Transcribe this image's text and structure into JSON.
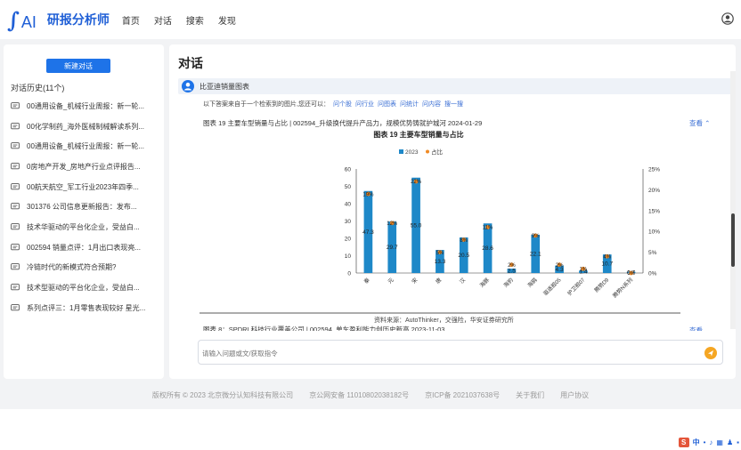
{
  "brand": {
    "logo_mark": "∫",
    "logo_text": "AI",
    "name": "研报分析师"
  },
  "nav": [
    "首页",
    "对话",
    "搜索",
    "发现"
  ],
  "sidebar": {
    "new_chat_label": "新建对话",
    "history_title": "对话历史(11个)",
    "history": [
      "00通用设备_机械行业周报：新一轮...",
      "00化学制药_海外医械制械解读系列...",
      "00通用设备_机械行业周报：新一轮...",
      "0房地产开发_房地产行业点评报告...",
      "00航天航空_军工行业2023年四季...",
      "301376 公司信息更新报告：发布...",
      "技术华驱动的平台化企业，受益白...",
      "002594 销量点评：1月出口表现亮...",
      "冷链时代的新模式符合预期?",
      "技术型驱动的平台化企业，受益白...",
      "系列点评三：1月零售表现较好 星光..."
    ]
  },
  "main": {
    "title": "对话",
    "question": "比亚迪销量图表",
    "answer_intro": "以下答案来自于一个检索到的图片,您还可以：",
    "links": [
      "问个股",
      "问行业",
      "问图表",
      "问统计",
      "问内容",
      "搜一搜"
    ],
    "figure_caption": "图表 19 主要车型销量与占比 | 002594_升级换代提升产品力，规模优势铸就护城河  2024-01-29",
    "view_label": "查看",
    "figure2_caption": "图表 8：SPDRI 科技行业覆盖公司 | 002594_单车盈利能力创历史新高  2023-11-03",
    "view2_label": "查看",
    "input_placeholder": "请输入问题或文/获取指令"
  },
  "chart_data": {
    "type": "bar",
    "title": "图表 19 主要车型销量与占比",
    "legend": [
      "2023",
      "占比"
    ],
    "legend_position": "top-center",
    "source": "资料来源：AutoThinker，交强险，华安证券研究所",
    "categories": [
      "秦",
      "元",
      "宋",
      "唐",
      "汉",
      "海豚",
      "海豹",
      "海鸥",
      "驱逐舰05",
      "护卫舰07",
      "腾势D9",
      "腾势N系列"
    ],
    "series": [
      {
        "name": "2023",
        "axis": "left",
        "color": "#1e88c8",
        "values": [
          47.3,
          29.7,
          55.0,
          13.3,
          20.5,
          28.6,
          2.5,
          22.1,
          4.3,
          1.4,
          10.7,
          0.7
        ]
      },
      {
        "name": "占比",
        "axis": "right",
        "color": "#f08a24",
        "values": [
          19,
          12,
          22,
          5,
          8,
          11,
          2,
          9,
          2,
          1,
          4,
          0
        ]
      }
    ],
    "ylim": [
      0,
      60
    ],
    "y_ticks": [
      0,
      10,
      20,
      30,
      40,
      50,
      60
    ],
    "y2lim": [
      0,
      25
    ],
    "y2_ticks": [
      "0%",
      "5%",
      "10%",
      "15%",
      "20%",
      "25%"
    ],
    "data_labels": [
      "47.3",
      "29.7",
      "55.0",
      "13.3",
      "20.5",
      "28.6",
      "2.5",
      "22.1",
      "4.3",
      "1.4",
      "10.7",
      "0.7"
    ],
    "share_labels": [
      "19%",
      "12%",
      "22%",
      "5%",
      "8%",
      "11%",
      "2%",
      "9%",
      "2%",
      "1%",
      "4%",
      "0%"
    ]
  },
  "footer": {
    "copyright": "版权所有 © 2023 北京微分认知科技有限公司",
    "icp1": "京公网安备 11010802038182号",
    "icp2": "京ICP备 2021037638号",
    "about": "关于我们",
    "agreement": "用户协议"
  },
  "tray": [
    "中",
    "•",
    "♪",
    "▦",
    "♟",
    "▪"
  ]
}
